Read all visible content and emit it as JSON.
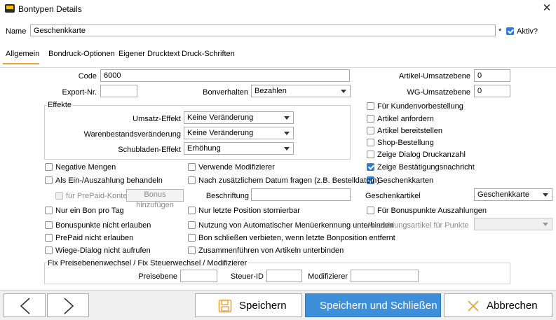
{
  "window": {
    "title": "Bontypen Details",
    "close_glyph": "✕"
  },
  "header": {
    "name_label": "Name",
    "name_value": "Geschenkkarte",
    "required_mark": "*",
    "aktiv_label": "Aktiv?",
    "aktiv_checked": true
  },
  "tabs": [
    "Allgemein",
    "Bondruck-Optionen",
    "Eigener Drucktext",
    "Druck-Schriften"
  ],
  "active_tab": "Allgemein",
  "fields": {
    "code_label": "Code",
    "code_value": "6000",
    "export_label": "Export-Nr.",
    "export_value": "",
    "bonverhalten_label": "Bonverhalten",
    "bonverhalten_value": "Bezahlen",
    "artikel_ums_label": "Artikel-Umsatzebene",
    "artikel_ums_value": "0",
    "wg_ums_label": "WG-Umsatzebene",
    "wg_ums_value": "0"
  },
  "effekte": {
    "title": "Effekte",
    "umsatz_label": "Umsatz-Effekt",
    "umsatz_value": "Keine Veränderung",
    "waren_label": "Warenbestandsveränderung",
    "waren_value": "Keine Veränderung",
    "schubladen_label": "Schubladen-Effekt",
    "schubladen_value": "Erhöhung"
  },
  "right_checks": [
    {
      "label": "Für Kundenvorbestellung",
      "checked": false
    },
    {
      "label": "Artikel anfordern",
      "checked": false
    },
    {
      "label": "Artikel bereitstellen",
      "checked": false
    },
    {
      "label": "Shop-Bestellung",
      "checked": false
    },
    {
      "label": "Zeige Dialog Druckanzahl",
      "checked": false
    },
    {
      "label": "Zeige Bestätigungsnachricht",
      "checked": true
    },
    {
      "label": "Geschenkkarten",
      "checked": true
    }
  ],
  "left_checks": {
    "negative": {
      "label": "Negative Mengen",
      "checked": false
    },
    "einaus": {
      "label": "Als Ein-/Auszahlung behandeln",
      "checked": false
    },
    "prepaid_konten": {
      "label": "für PrePaid-Konten",
      "checked": false
    },
    "bonus_hinzu": "Bonus hinzufügen",
    "nur_ein_bon": {
      "label": "Nur ein Bon pro Tag",
      "checked": false
    },
    "bonuspunkte": {
      "label": "Bonuspunkte nicht erlauben",
      "checked": false
    },
    "prepaid": {
      "label": "PrePaid nicht erlauben",
      "checked": false
    },
    "wiege": {
      "label": "Wiege-Dialog nicht aufrufen",
      "checked": false
    }
  },
  "mid_checks": {
    "modifizierer": {
      "label": "Verwende Modifizierer",
      "checked": false
    },
    "zusaetzlich": {
      "label": "Nach zusätzlichem Datum fragen (z.B. Bestelldatum)",
      "checked": false
    },
    "beschriftung_label": "Beschriftung",
    "beschriftung_value": "",
    "nur_letzte": {
      "label": "Nur letzte Position stornierbar",
      "checked": false
    },
    "nutzung": {
      "label": "Nutzung von Automatischer Menüerkennung unterbinden",
      "checked": false
    },
    "bon_schliessen": {
      "label": "Bon schließen verbieten, wenn letzte Bonposition entfernt",
      "checked": false
    },
    "zusammen": {
      "label": "Zusammenführen von Artikeln unterbinden",
      "checked": false
    }
  },
  "geschenk": {
    "artikel_label": "Geschenkartikel",
    "artikel_value": "Geschenkkarte",
    "bonus_ausz": {
      "label": "Für Bonuspunkte Auszahlungen",
      "checked": false
    },
    "ausz_artikel_label": "Auszahlungsartikel für Punkte",
    "ausz_artikel_value": ""
  },
  "fix": {
    "title": "Fix Preisebenenwechsel / Fix Steuerwechsel / Modifizierer",
    "preisebene_label": "Preisebene",
    "preisebene_value": "",
    "steuer_label": "Steuer-ID",
    "steuer_value": "",
    "modifizierer_label": "Modifizierer",
    "modifizierer_value": ""
  },
  "footer": {
    "prev_icon": "chevron-left-icon",
    "next_icon": "chevron-right-icon",
    "save": "Speichern",
    "save_close": "Speichern und Schließen",
    "cancel": "Abbrechen"
  },
  "colors": {
    "accent": "#3d8fd9",
    "tab_underline": "#e8a33d",
    "save_icon": "#e8a33d"
  }
}
